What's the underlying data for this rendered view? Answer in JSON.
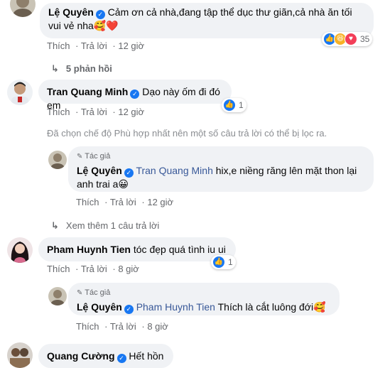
{
  "c1": {
    "name": "Lệ Quyên",
    "text_line1": "Cảm ơn cả nhà,đang tập thể dục thư giãn,cả nhà ăn tối",
    "text_line2": "vui vẻ nha",
    "emoji": "🥰❤️",
    "reaction_count": "35",
    "like": "Thích",
    "reply": "Trả lời",
    "time": "12 giờ"
  },
  "c1_replies": {
    "label": "5 phản hồi"
  },
  "c2": {
    "name": "Tran Quang Minh",
    "text": "Dạo này ốm đi đó em",
    "reaction_count": "1",
    "like": "Thích",
    "reply": "Trả lời",
    "time": "12 giờ"
  },
  "filter_notice": "Đã chọn chế độ Phù hợp nhất nên một số câu trả lời có thể bị lọc ra.",
  "r1": {
    "author_tag": "Tác giả",
    "name": "Lệ Quyên",
    "mention": "Tran Quang Minh",
    "text_line1": "hix,e niềng răng lên mặt thon lại",
    "text_line2": "anh trai a",
    "emoji": "😀",
    "like": "Thích",
    "reply": "Trả lời",
    "time": "12 giờ"
  },
  "more_replies": "Xem thêm 1 câu trả lời",
  "c3": {
    "name": "Pham Huynh Tien",
    "text": "tóc đẹp quá tình iu ui",
    "reaction_count": "1",
    "like": "Thích",
    "reply": "Trả lời",
    "time": "8 giờ"
  },
  "r2": {
    "author_tag": "Tác giả",
    "name": "Lệ Quyên",
    "mention": "Pham Huynh Tien",
    "text": "Thích là cắt luông đới",
    "emoji": "🥰",
    "like": "Thích",
    "reply": "Trả lời",
    "time": "8 giờ"
  },
  "c4": {
    "name": "Quang Cường",
    "text": "Hết hồn"
  },
  "colors": {
    "link": "#385898",
    "bubble": "#f0f2f5",
    "meta": "#65676b"
  }
}
